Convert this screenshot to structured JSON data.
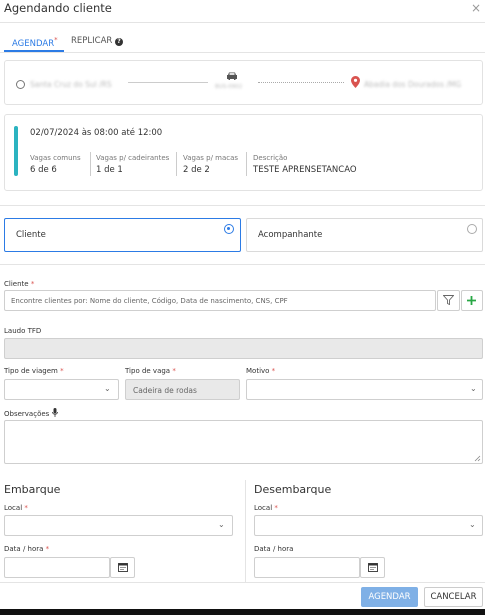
{
  "dialog": {
    "title": "Agendando cliente",
    "close": "×"
  },
  "tabs": {
    "agendar": "AGENDAR",
    "agendar_req": "*",
    "replicar": "REPLICAR",
    "replicar_help": "❓"
  },
  "route": {
    "origin": "Santa Cruz do Sul /RS",
    "destination": "Abadia dos Dourados /MG",
    "vehicle_caption": "BUS-0902",
    "vehicle_icon": "car-icon"
  },
  "vaga": {
    "datetime": "02/07/2024 às 08:00 até 12:00",
    "comuns_label": "Vagas comuns",
    "comuns_value": "6 de 6",
    "cadeirantes_label": "Vagas p/ cadeirantes",
    "cadeirantes_value": "1 de 1",
    "macas_label": "Vagas p/ macas",
    "macas_value": "2 de 2",
    "descricao_label": "Descrição",
    "descricao_value": "TESTE APRENSETANCAO",
    "accent_color": "#2bb3c0"
  },
  "options": {
    "cliente": "Cliente",
    "acompanhante": "Acompanhante",
    "selected": "Cliente"
  },
  "form": {
    "cliente_label": "Cliente",
    "req": "*",
    "cliente_placeholder": "Encontre clientes por: Nome do cliente, Código, Data de nascimento, CNS, CPF",
    "laudo_label": "Laudo TFD",
    "tipo_viagem_label": "Tipo de viagem",
    "tipo_vaga_label": "Tipo de vaga",
    "tipo_vaga_value": "Cadeira de rodas",
    "motivo_label": "Motivo",
    "observacoes_label": "Observações"
  },
  "embarque": {
    "title": "Embarque",
    "local_label": "Local",
    "datahora_label": "Data / hora"
  },
  "desembarque": {
    "title": "Desembarque",
    "local_label": "Local",
    "datahora_label": "Data / hora"
  },
  "buttons": {
    "agendar": "AGENDAR",
    "cancelar": "CANCELAR"
  },
  "colors": {
    "primary": "#2c7be5",
    "required": "#d9534f",
    "add": "#28a745",
    "pin": "#d9534f"
  }
}
